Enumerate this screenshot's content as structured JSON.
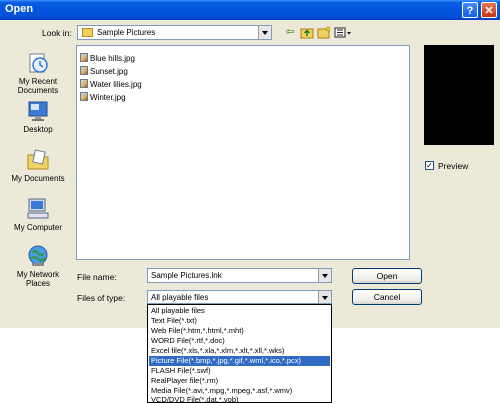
{
  "window": {
    "title": "Open",
    "help_label": "?",
    "close_label": "✕"
  },
  "look_in": {
    "label": "Look in:",
    "value": "Sample Pictures"
  },
  "places": [
    {
      "label": "My Recent Documents",
      "icon": "recent-documents-icon"
    },
    {
      "label": "Desktop",
      "icon": "desktop-icon"
    },
    {
      "label": "My Documents",
      "icon": "my-documents-icon"
    },
    {
      "label": "My Computer",
      "icon": "my-computer-icon"
    },
    {
      "label": "My Network Places",
      "icon": "network-places-icon"
    }
  ],
  "files": [
    {
      "name": "Blue hills.jpg"
    },
    {
      "name": "Sunset.jpg"
    },
    {
      "name": "Water lilies.jpg"
    },
    {
      "name": "Winter.jpg"
    }
  ],
  "preview": {
    "label": "Preview",
    "checked": true
  },
  "file_name": {
    "label": "File name:",
    "value": "Sample Pictures.lnk"
  },
  "file_type": {
    "label": "Files of type:",
    "value": "All playable files",
    "options": [
      "All playable files",
      "Text File(*.txt)",
      "Web File(*.htm,*.html,*.mht)",
      "WORD File(*.rtf,*.doc)",
      "Excel file(*.xls,*.xla,*.xlm,*.xlt,*.xll,*.wks)",
      "Picture File(*.bmp,*.jpg,*.gif,*.wml,*.ico,*.pcx)",
      "FLASH File(*.swf)",
      "RealPlayer file(*.rm)",
      "Media File(*.avi,*.mpg,*.mpeg,*.asf,*.wmv)",
      "VCD/DVD File(*.dat,*.vob)"
    ],
    "selected_option": "Picture File(*.bmp,*.jpg,*.gif,*.wml,*.ico,*.pcx)"
  },
  "buttons": {
    "open_label": "Open",
    "cancel_label": "Cancel"
  },
  "colors": {
    "titlebar": "#0355de",
    "dialog_bg": "#ece9d8",
    "selection": "#316ac5"
  }
}
